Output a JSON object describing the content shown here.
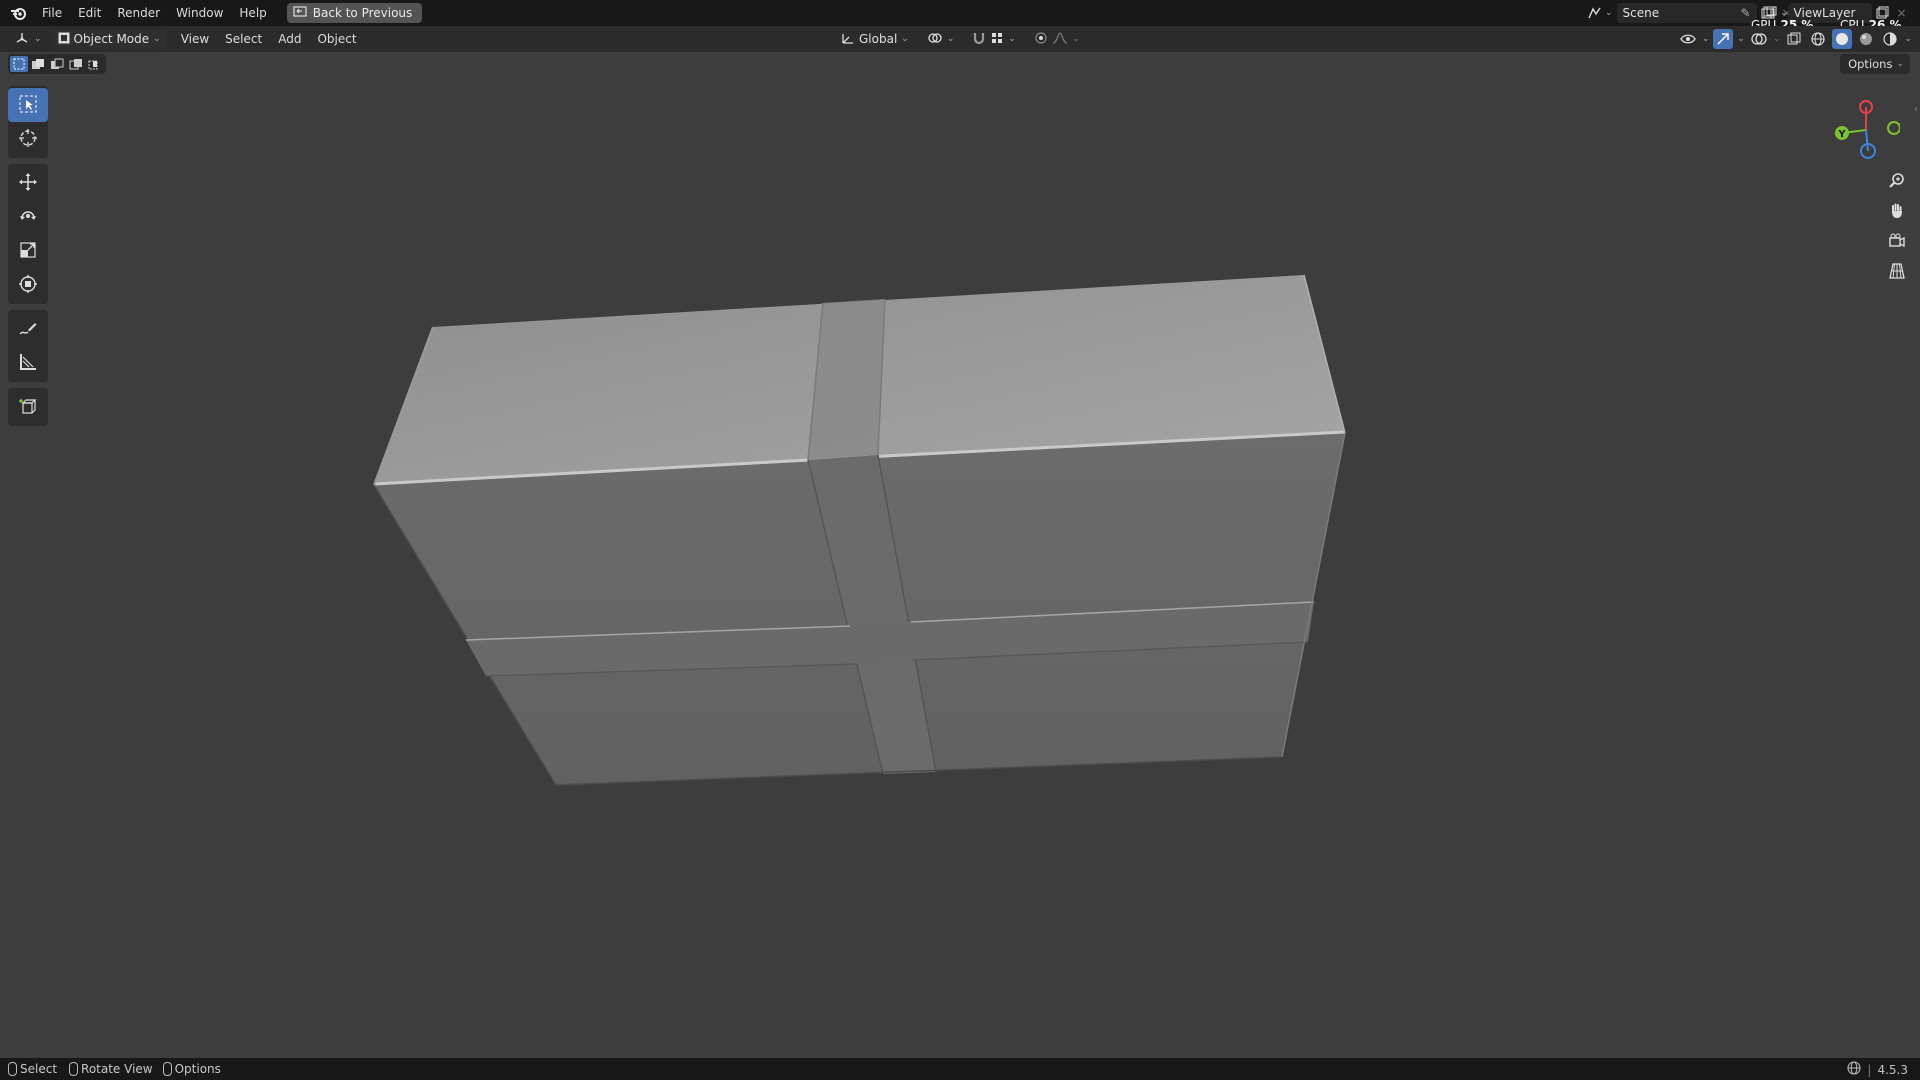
{
  "menu": {
    "items": [
      "File",
      "Edit",
      "Render",
      "Window",
      "Help"
    ],
    "back_label": "Back to Previous"
  },
  "topright": {
    "scene_name": "Scene",
    "view_layer": "ViewLayer",
    "gpu_label": "GPU",
    "gpu_value": "25 %",
    "cpu_label": "CPU",
    "cpu_value": "26 %"
  },
  "header": {
    "mode": "Object Mode",
    "menus": [
      "View",
      "Select",
      "Add",
      "Object"
    ],
    "orientation": "Global",
    "options_label": "Options"
  },
  "status": {
    "select": "Select",
    "rotate": "Rotate View",
    "options": "Options",
    "version": "4.5.3"
  },
  "gizmo": {
    "x_color": "#e2404b",
    "y_color": "#7ac231",
    "z_color": "#3d86e0",
    "y_label": "Y"
  },
  "colors": {
    "accent": "#4772b3",
    "viewport_bg": "#3d3d3d"
  }
}
